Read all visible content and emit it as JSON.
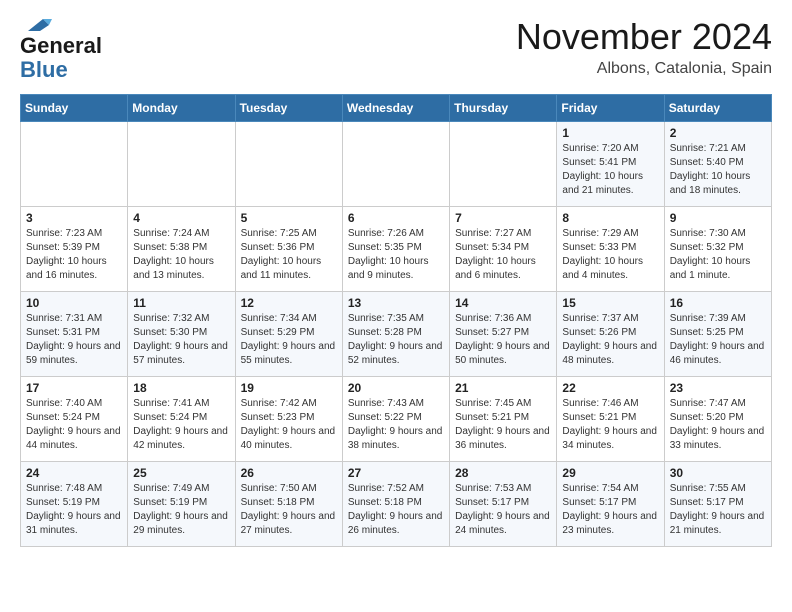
{
  "header": {
    "logo_general": "General",
    "logo_blue": "Blue",
    "month_title": "November 2024",
    "location": "Albons, Catalonia, Spain"
  },
  "days_of_week": [
    "Sunday",
    "Monday",
    "Tuesday",
    "Wednesday",
    "Thursday",
    "Friday",
    "Saturday"
  ],
  "weeks": [
    [
      {
        "day": "",
        "info": ""
      },
      {
        "day": "",
        "info": ""
      },
      {
        "day": "",
        "info": ""
      },
      {
        "day": "",
        "info": ""
      },
      {
        "day": "",
        "info": ""
      },
      {
        "day": "1",
        "info": "Sunrise: 7:20 AM\nSunset: 5:41 PM\nDaylight: 10 hours and 21 minutes."
      },
      {
        "day": "2",
        "info": "Sunrise: 7:21 AM\nSunset: 5:40 PM\nDaylight: 10 hours and 18 minutes."
      }
    ],
    [
      {
        "day": "3",
        "info": "Sunrise: 7:23 AM\nSunset: 5:39 PM\nDaylight: 10 hours and 16 minutes."
      },
      {
        "day": "4",
        "info": "Sunrise: 7:24 AM\nSunset: 5:38 PM\nDaylight: 10 hours and 13 minutes."
      },
      {
        "day": "5",
        "info": "Sunrise: 7:25 AM\nSunset: 5:36 PM\nDaylight: 10 hours and 11 minutes."
      },
      {
        "day": "6",
        "info": "Sunrise: 7:26 AM\nSunset: 5:35 PM\nDaylight: 10 hours and 9 minutes."
      },
      {
        "day": "7",
        "info": "Sunrise: 7:27 AM\nSunset: 5:34 PM\nDaylight: 10 hours and 6 minutes."
      },
      {
        "day": "8",
        "info": "Sunrise: 7:29 AM\nSunset: 5:33 PM\nDaylight: 10 hours and 4 minutes."
      },
      {
        "day": "9",
        "info": "Sunrise: 7:30 AM\nSunset: 5:32 PM\nDaylight: 10 hours and 1 minute."
      }
    ],
    [
      {
        "day": "10",
        "info": "Sunrise: 7:31 AM\nSunset: 5:31 PM\nDaylight: 9 hours and 59 minutes."
      },
      {
        "day": "11",
        "info": "Sunrise: 7:32 AM\nSunset: 5:30 PM\nDaylight: 9 hours and 57 minutes."
      },
      {
        "day": "12",
        "info": "Sunrise: 7:34 AM\nSunset: 5:29 PM\nDaylight: 9 hours and 55 minutes."
      },
      {
        "day": "13",
        "info": "Sunrise: 7:35 AM\nSunset: 5:28 PM\nDaylight: 9 hours and 52 minutes."
      },
      {
        "day": "14",
        "info": "Sunrise: 7:36 AM\nSunset: 5:27 PM\nDaylight: 9 hours and 50 minutes."
      },
      {
        "day": "15",
        "info": "Sunrise: 7:37 AM\nSunset: 5:26 PM\nDaylight: 9 hours and 48 minutes."
      },
      {
        "day": "16",
        "info": "Sunrise: 7:39 AM\nSunset: 5:25 PM\nDaylight: 9 hours and 46 minutes."
      }
    ],
    [
      {
        "day": "17",
        "info": "Sunrise: 7:40 AM\nSunset: 5:24 PM\nDaylight: 9 hours and 44 minutes."
      },
      {
        "day": "18",
        "info": "Sunrise: 7:41 AM\nSunset: 5:24 PM\nDaylight: 9 hours and 42 minutes."
      },
      {
        "day": "19",
        "info": "Sunrise: 7:42 AM\nSunset: 5:23 PM\nDaylight: 9 hours and 40 minutes."
      },
      {
        "day": "20",
        "info": "Sunrise: 7:43 AM\nSunset: 5:22 PM\nDaylight: 9 hours and 38 minutes."
      },
      {
        "day": "21",
        "info": "Sunrise: 7:45 AM\nSunset: 5:21 PM\nDaylight: 9 hours and 36 minutes."
      },
      {
        "day": "22",
        "info": "Sunrise: 7:46 AM\nSunset: 5:21 PM\nDaylight: 9 hours and 34 minutes."
      },
      {
        "day": "23",
        "info": "Sunrise: 7:47 AM\nSunset: 5:20 PM\nDaylight: 9 hours and 33 minutes."
      }
    ],
    [
      {
        "day": "24",
        "info": "Sunrise: 7:48 AM\nSunset: 5:19 PM\nDaylight: 9 hours and 31 minutes."
      },
      {
        "day": "25",
        "info": "Sunrise: 7:49 AM\nSunset: 5:19 PM\nDaylight: 9 hours and 29 minutes."
      },
      {
        "day": "26",
        "info": "Sunrise: 7:50 AM\nSunset: 5:18 PM\nDaylight: 9 hours and 27 minutes."
      },
      {
        "day": "27",
        "info": "Sunrise: 7:52 AM\nSunset: 5:18 PM\nDaylight: 9 hours and 26 minutes."
      },
      {
        "day": "28",
        "info": "Sunrise: 7:53 AM\nSunset: 5:17 PM\nDaylight: 9 hours and 24 minutes."
      },
      {
        "day": "29",
        "info": "Sunrise: 7:54 AM\nSunset: 5:17 PM\nDaylight: 9 hours and 23 minutes."
      },
      {
        "day": "30",
        "info": "Sunrise: 7:55 AM\nSunset: 5:17 PM\nDaylight: 9 hours and 21 minutes."
      }
    ]
  ]
}
